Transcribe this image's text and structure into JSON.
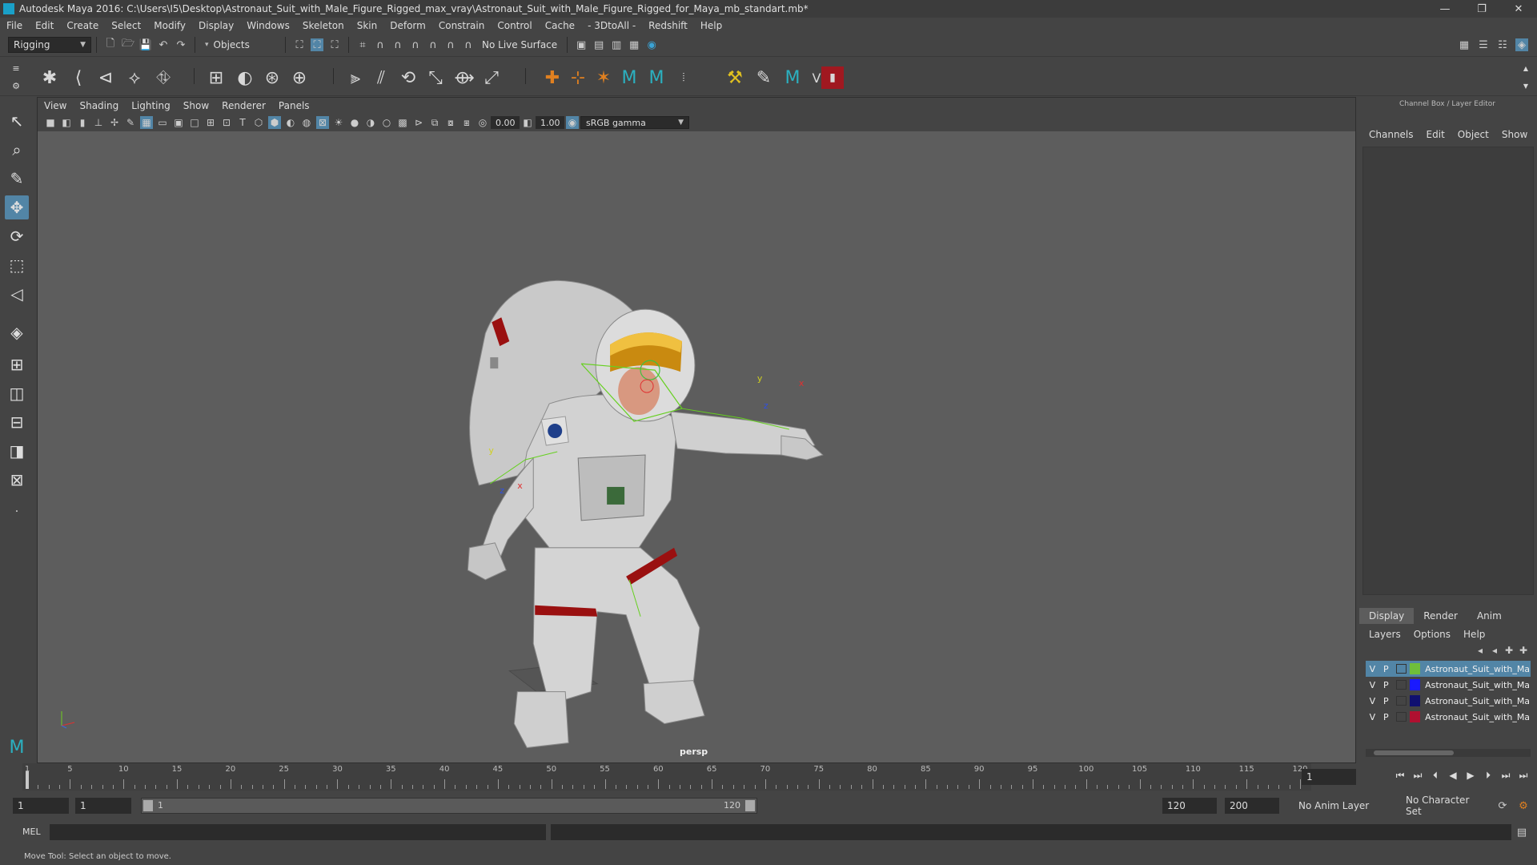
{
  "window": {
    "title": "Autodesk Maya 2016: C:\\Users\\I5\\Desktop\\Astronaut_Suit_with_Male_Figure_Rigged_max_vray\\Astronaut_Suit_with_Male_Figure_Rigged_for_Maya_mb_standart.mb*",
    "controls": [
      "—",
      "❐",
      "✕"
    ]
  },
  "menubar": [
    "File",
    "Edit",
    "Create",
    "Select",
    "Modify",
    "Display",
    "Windows",
    "Skeleton",
    "Skin",
    "Deform",
    "Constrain",
    "Control",
    "Cache",
    "- 3DtoAll -",
    "Redshift",
    "Help"
  ],
  "statusline": {
    "menuset": "Rigging",
    "selection_mode": "Objects",
    "live_surface": "No Live Surface"
  },
  "viewport": {
    "menu": [
      "View",
      "Shading",
      "Lighting",
      "Show",
      "Renderer",
      "Panels"
    ],
    "exposure": "0.00",
    "gamma": "1.00",
    "colorspace": "sRGB gamma",
    "camera": "persp"
  },
  "channelbox": {
    "header": "Channel Box / Layer Editor",
    "tabs": [
      "Channels",
      "Edit",
      "Object",
      "Show"
    ]
  },
  "layereditor": {
    "tabs": [
      "Display",
      "Render",
      "Anim"
    ],
    "selected_tab": "Display",
    "menu": [
      "Layers",
      "Options",
      "Help"
    ],
    "layers": [
      {
        "v": "V",
        "p": "P",
        "color": "#6fbf3a",
        "name": "Astronaut_Suit_with_Male",
        "selected": true
      },
      {
        "v": "V",
        "p": "P",
        "color": "#1a1aff",
        "name": "Astronaut_Suit_with_Male",
        "selected": false
      },
      {
        "v": "V",
        "p": "P",
        "color": "#101070",
        "name": "Astronaut_Suit_with_Male",
        "selected": false
      },
      {
        "v": "V",
        "p": "P",
        "color": "#b01030",
        "name": "Astronaut_Suit_with_Male",
        "selected": false
      }
    ]
  },
  "timeline": {
    "ticks": [
      "1",
      "5",
      "10",
      "15",
      "20",
      "25",
      "30",
      "35",
      "40",
      "45",
      "50",
      "55",
      "60",
      "65",
      "70",
      "75",
      "80",
      "85",
      "90",
      "95",
      "100",
      "105",
      "110",
      "115",
      "120"
    ],
    "current_frame": "1"
  },
  "range": {
    "start": "1",
    "playback_start": "1",
    "slider_start": "1",
    "slider_end": "120",
    "playback_end": "120",
    "end": "200",
    "anim_layer": "No Anim Layer",
    "character_set": "No Character Set"
  },
  "cmdline": {
    "label": "MEL"
  },
  "helpline": {
    "text": "Move Tool: Select an object to move."
  }
}
